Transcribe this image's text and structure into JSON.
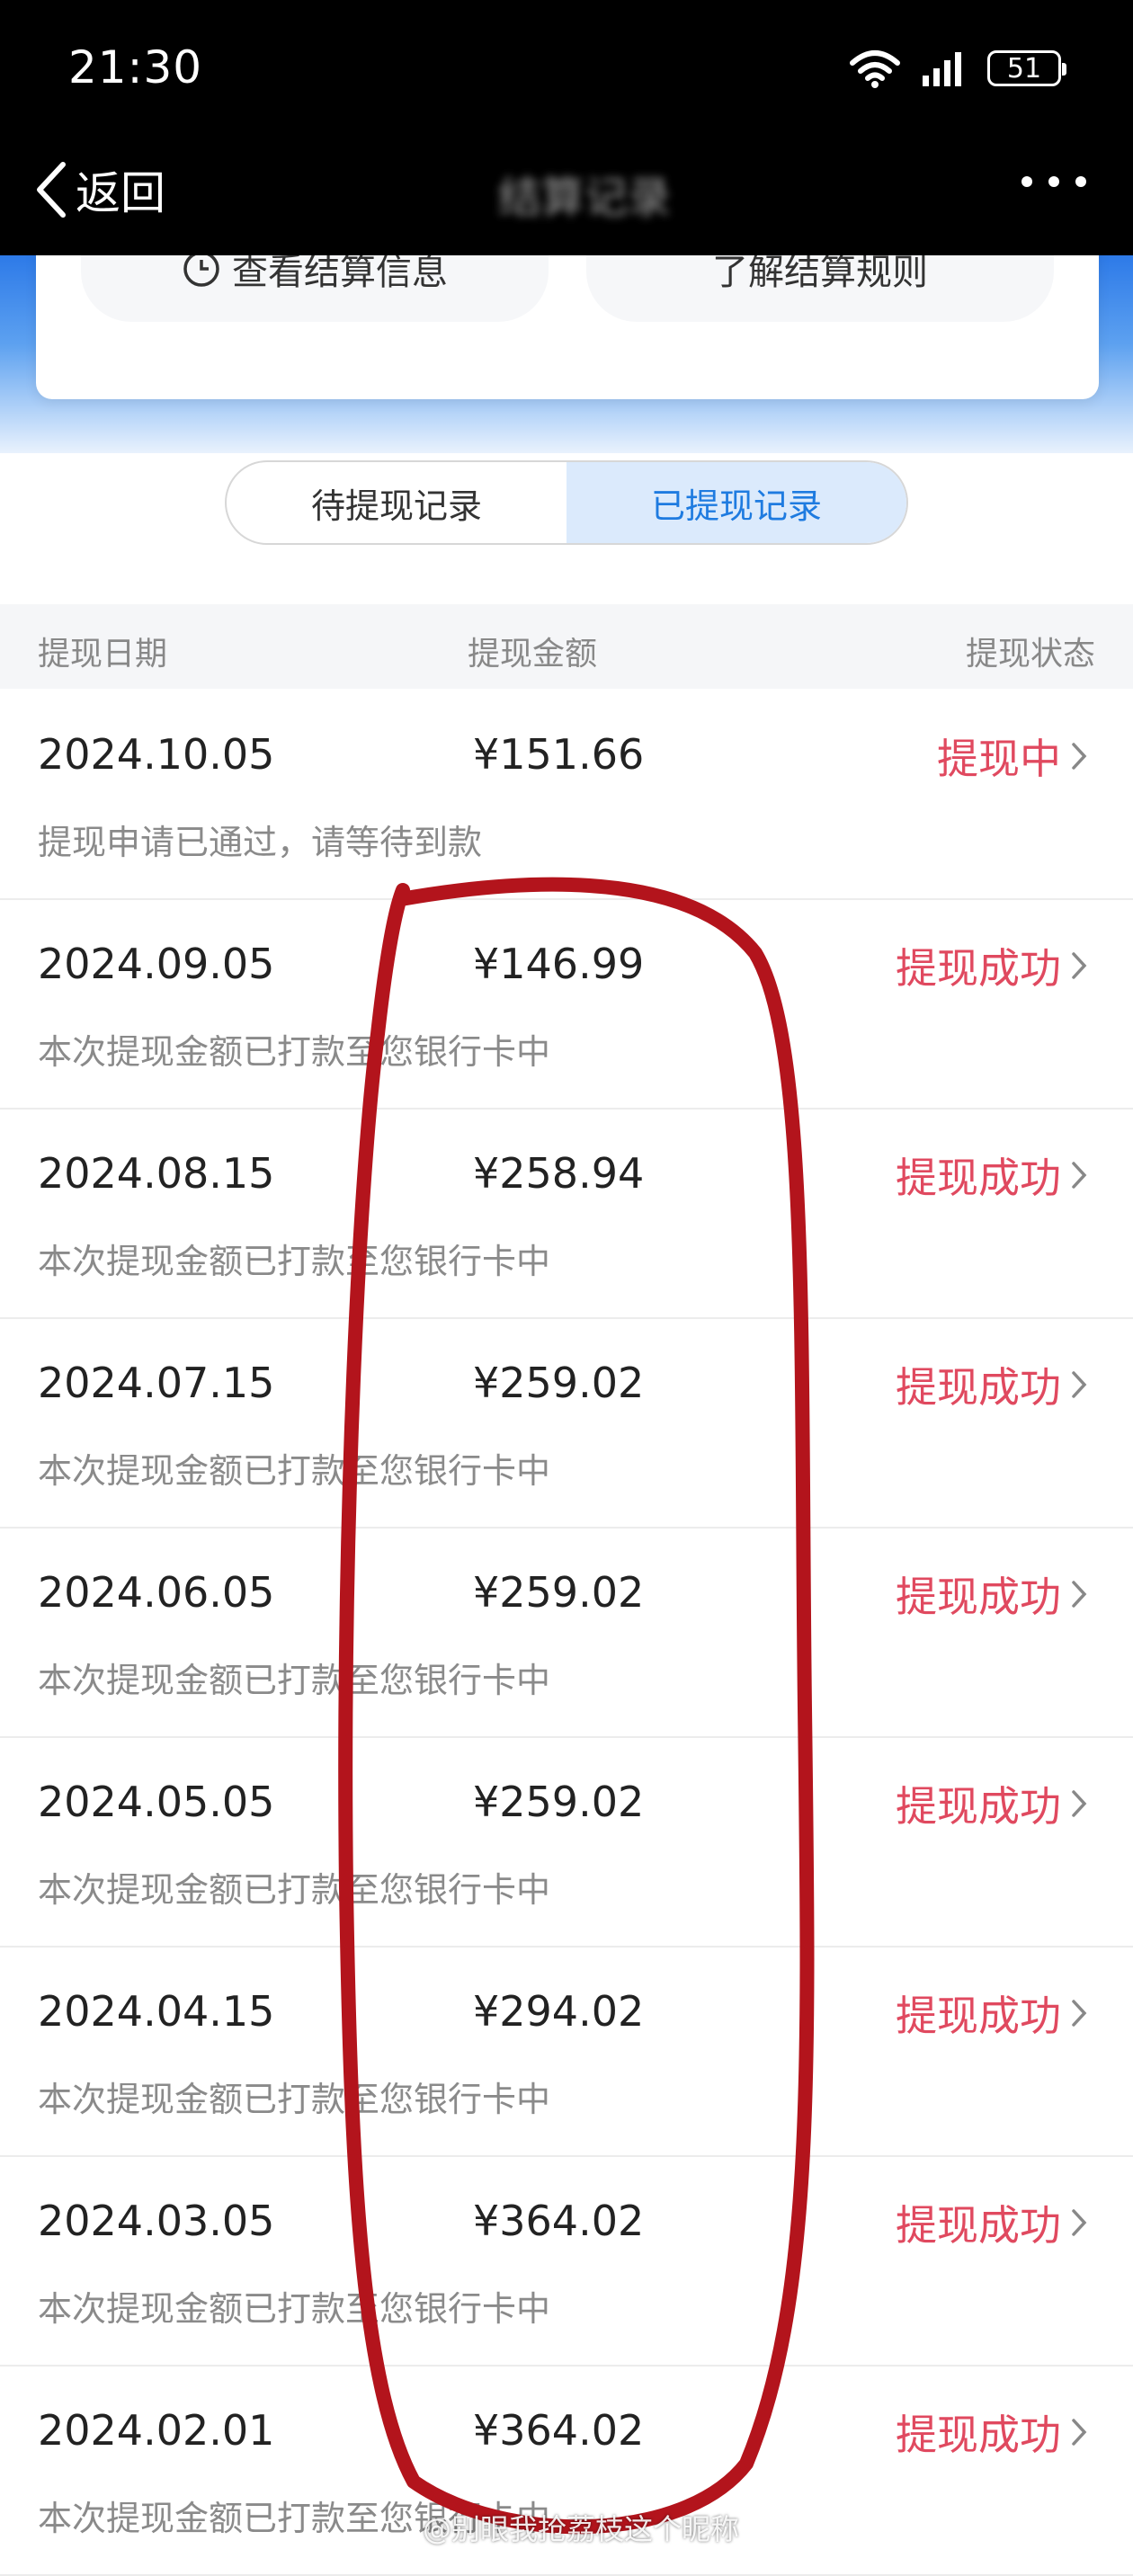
{
  "status_bar": {
    "time": "21:30",
    "battery": "51"
  },
  "nav": {
    "back_label": "返回",
    "title": "结算记录"
  },
  "info_card": {
    "left_button": "查看结算信息",
    "right_button": "了解结算规则"
  },
  "tabs": [
    {
      "label": "待提现记录",
      "active": false
    },
    {
      "label": "已提现记录",
      "active": true
    }
  ],
  "table": {
    "headers": {
      "date": "提现日期",
      "amount": "提现金额",
      "status": "提现状态"
    },
    "rows": [
      {
        "date": "2024.10.05",
        "amount": "¥151.66",
        "status": "提现中",
        "note": "提现申请已通过，请等待到款"
      },
      {
        "date": "2024.09.05",
        "amount": "¥146.99",
        "status": "提现成功",
        "note": "本次提现金额已打款至您银行卡中"
      },
      {
        "date": "2024.08.15",
        "amount": "¥258.94",
        "status": "提现成功",
        "note": "本次提现金额已打款至您银行卡中"
      },
      {
        "date": "2024.07.15",
        "amount": "¥259.02",
        "status": "提现成功",
        "note": "本次提现金额已打款至您银行卡中"
      },
      {
        "date": "2024.06.05",
        "amount": "¥259.02",
        "status": "提现成功",
        "note": "本次提现金额已打款至您银行卡中"
      },
      {
        "date": "2024.05.05",
        "amount": "¥259.02",
        "status": "提现成功",
        "note": "本次提现金额已打款至您银行卡中"
      },
      {
        "date": "2024.04.15",
        "amount": "¥294.02",
        "status": "提现成功",
        "note": "本次提现金额已打款至您银行卡中"
      },
      {
        "date": "2024.03.05",
        "amount": "¥364.02",
        "status": "提现成功",
        "note": "本次提现金额已打款至您银行卡中"
      },
      {
        "date": "2024.02.01",
        "amount": "¥364.02",
        "status": "提现成功",
        "note": "本次提现金额已打款至您银行卡中"
      }
    ]
  },
  "watermark": "@别眼我抢荔枝这个昵称",
  "colors": {
    "accent": "#1e7be0",
    "status": "#e0495f",
    "annotation": "#b3141c"
  }
}
